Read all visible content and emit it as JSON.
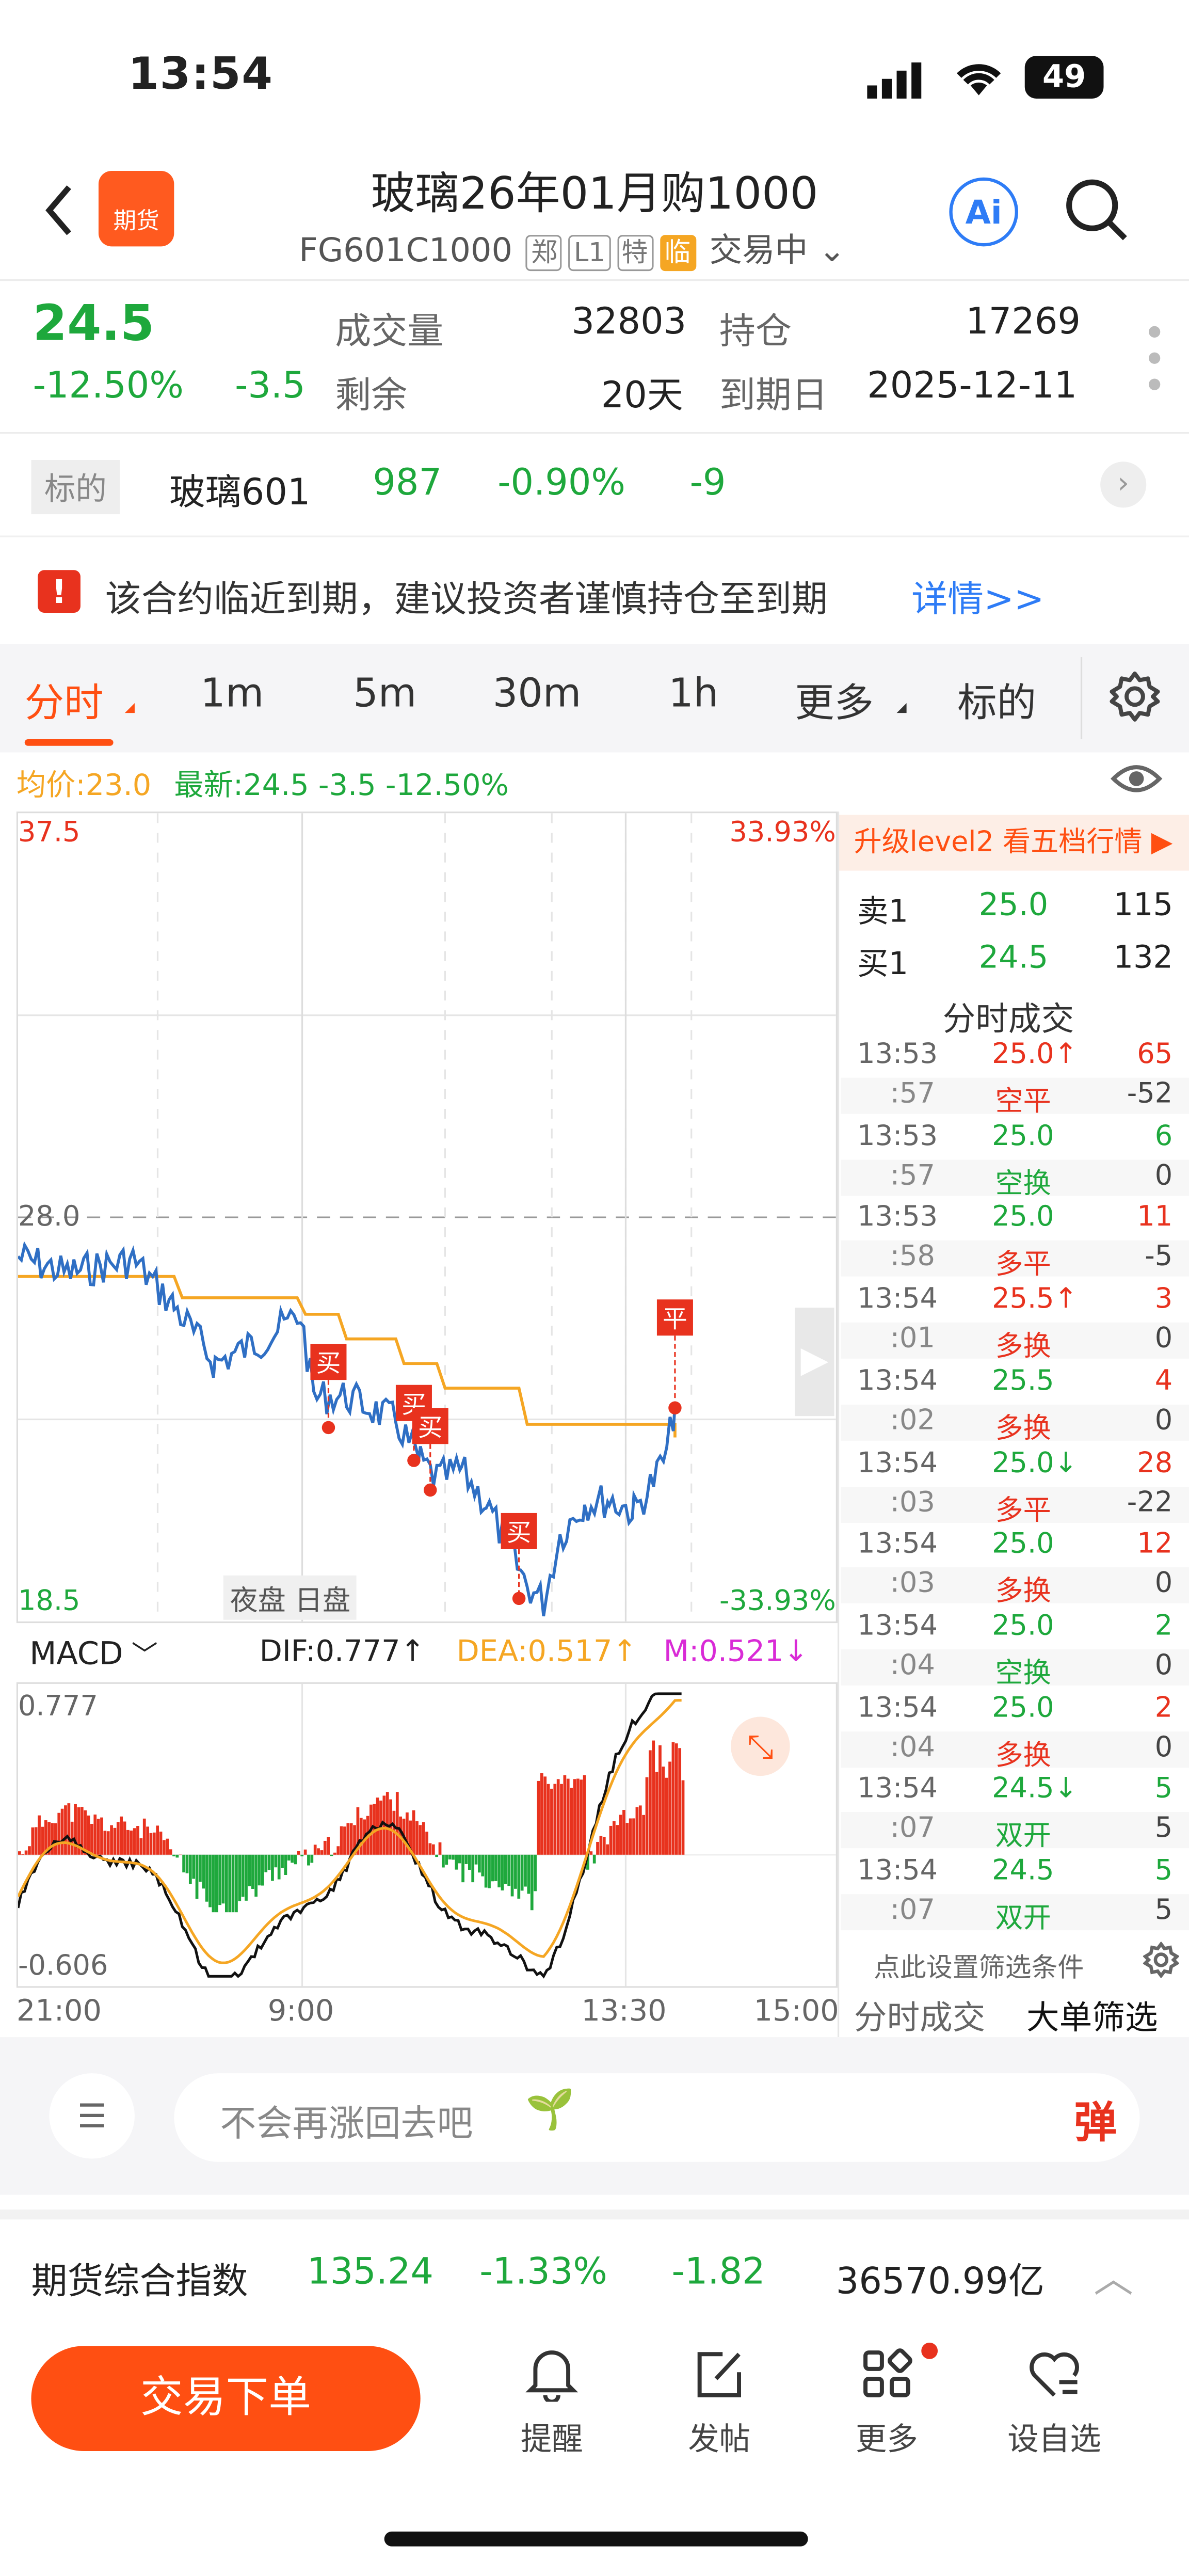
{
  "status": {
    "time": "13:54",
    "battery": "49"
  },
  "header": {
    "title": "玻璃26年01月购1000",
    "code": "FG601C1000",
    "tags": [
      "郑",
      "L1",
      "特",
      "临"
    ],
    "state": "交易中",
    "logo_text": "期货",
    "ai_label": "Ai"
  },
  "quote": {
    "price": "24.5",
    "change_pct": "-12.50%",
    "change": "-3.5",
    "volume_label": "成交量",
    "volume": "32803",
    "oi_label": "持仓",
    "oi": "17269",
    "remain_label": "剩余",
    "remain": "20天",
    "expiry_label": "到期日",
    "expiry": "2025-12-11"
  },
  "underlying": {
    "tag": "标的",
    "name": "玻璃601",
    "price": "987",
    "pct": "-0.90%",
    "change": "-9"
  },
  "notice": {
    "text": "该合约临近到期，建议投资者谨慎持仓至到期",
    "link": "详情>>"
  },
  "tabs": [
    "分时",
    "1m",
    "5m",
    "30m",
    "1h",
    "更多",
    "标的"
  ],
  "chart_info": {
    "avg": "均价:23.0",
    "latest": "最新:24.5 -3.5 -12.50%"
  },
  "chart": {
    "y_top": "37.5",
    "y_mid": "28.0",
    "y_bottom": "18.5",
    "pct_top": "33.93%",
    "pct_bottom": "-33.93%",
    "session_night": "夜盘",
    "session_day": "日盘",
    "x_labels": [
      "21:00",
      "9:00",
      "13:30",
      "15:00"
    ],
    "markers": [
      "买",
      "买",
      "买",
      "买",
      "平"
    ]
  },
  "macd": {
    "label": "MACD",
    "dif": "DIF:0.777↑",
    "dea": "DEA:0.517↑",
    "m": "M:0.521↓",
    "max": "0.777",
    "min": "-0.606"
  },
  "right_panel": {
    "upgrade": "升级level2 看五档行情 ▶",
    "sell_label": "卖1",
    "sell_price": "25.0",
    "sell_vol": "115",
    "buy_label": "买1",
    "buy_price": "24.5",
    "buy_vol": "132",
    "trades_title": "分时成交",
    "trades": [
      {
        "t1": "13:53",
        "t2": ":57",
        "price": "25.0↑",
        "type": "空平",
        "vol": "65",
        "oi": "-52"
      },
      {
        "t1": "13:53",
        "t2": ":57",
        "price": "25.0",
        "type": "空换",
        "vol": "6",
        "oi": "0"
      },
      {
        "t1": "13:53",
        "t2": ":58",
        "price": "25.0",
        "type": "多平",
        "vol": "11",
        "oi": "-5"
      },
      {
        "t1": "13:54",
        "t2": ":01",
        "price": "25.5↑",
        "type": "多换",
        "vol": "3",
        "oi": "0"
      },
      {
        "t1": "13:54",
        "t2": ":02",
        "price": "25.5",
        "type": "多换",
        "vol": "4",
        "oi": "0"
      },
      {
        "t1": "13:54",
        "t2": ":03",
        "price": "25.0↓",
        "type": "多平",
        "vol": "28",
        "oi": "-22"
      },
      {
        "t1": "13:54",
        "t2": ":03",
        "price": "25.0",
        "type": "多换",
        "vol": "12",
        "oi": "0"
      },
      {
        "t1": "13:54",
        "t2": ":04",
        "price": "25.0",
        "type": "空换",
        "vol": "2",
        "oi": "0"
      },
      {
        "t1": "13:54",
        "t2": ":04",
        "price": "25.0",
        "type": "多换",
        "vol": "2",
        "oi": "0"
      },
      {
        "t1": "13:54",
        "t2": ":07",
        "price": "24.5↓",
        "type": "双开",
        "vol": "5",
        "oi": "5"
      },
      {
        "t1": "13:54",
        "t2": ":07",
        "price": "24.5",
        "type": "双开",
        "vol": "5",
        "oi": "5"
      }
    ],
    "filter_hint": "点此设置筛选条件",
    "tab_trades": "分时成交",
    "tab_big": "大单筛选"
  },
  "comment": {
    "placeholder": "不会再涨回去吧",
    "danmu": "弹"
  },
  "index_bar": {
    "name": "期货综合指数",
    "value": "135.24",
    "pct": "-1.33%",
    "change": "-1.82",
    "amount": "36570.99亿"
  },
  "bottom": {
    "trade_button": "交易下单",
    "nav": [
      "提醒",
      "发帖",
      "更多",
      "设自选"
    ]
  }
}
